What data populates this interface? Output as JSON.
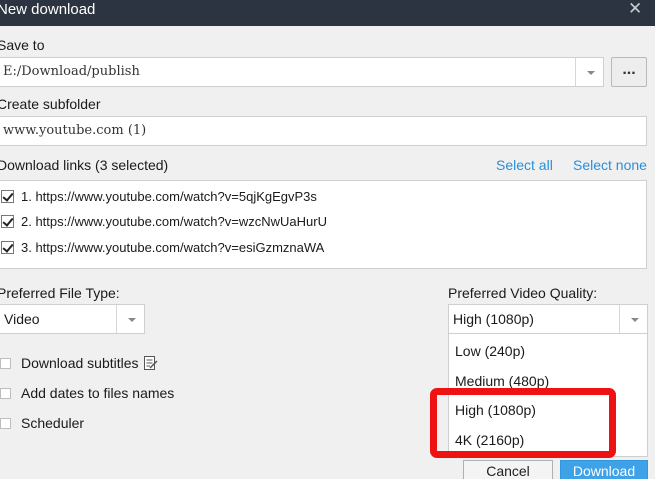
{
  "dialog": {
    "title": "New download",
    "close_glyph": "✕"
  },
  "save_to": {
    "label": "Save to",
    "path": "E:/Download/publish",
    "browse_label": "..."
  },
  "subfolder": {
    "label": "Create subfolder",
    "value": "www.youtube.com (1)"
  },
  "links": {
    "label": "Download links (3 selected)",
    "select_all": "Select all",
    "select_none": "Select none",
    "items": [
      {
        "text": "1. https://www.youtube.com/watch?v=5qjKgEgvP3s",
        "checked": true
      },
      {
        "text": "2. https://www.youtube.com/watch?v=wzcNwUaHurU",
        "checked": true
      },
      {
        "text": "3. https://www.youtube.com/watch?v=esiGzmznaWA",
        "checked": true
      }
    ]
  },
  "file_type": {
    "label": "Preferred File Type:",
    "value": "Video"
  },
  "options": {
    "subtitles": "Download subtitles",
    "dates": "Add dates to files names",
    "scheduler": "Scheduler"
  },
  "quality": {
    "label": "Preferred Video Quality:",
    "value": "High (1080p)",
    "options": [
      "Low (240p)",
      "Medium (480p)",
      "High (1080p)",
      "4K (2160p)"
    ]
  },
  "buttons": {
    "cancel": "Cancel",
    "download": "Download"
  },
  "colors": {
    "titlebar": "#2d3441",
    "link": "#2b8fd8",
    "primary_button": "#3ea2e8",
    "annotation_box": "#ee1212"
  }
}
